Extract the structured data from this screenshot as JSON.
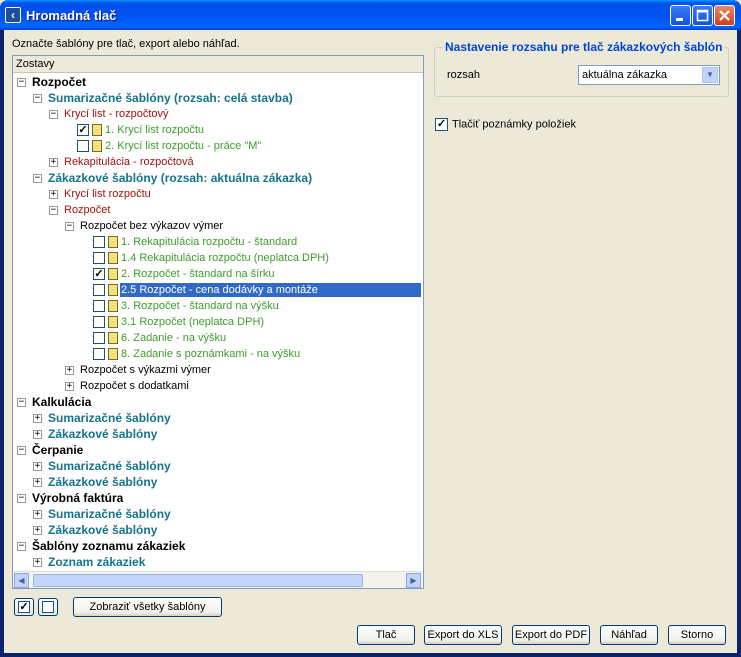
{
  "window": {
    "title": "Hromadná tlač"
  },
  "instruction": "Označte šablóny pre tlač, export alebo náhľad.",
  "tree": {
    "header": "Zostavy",
    "rows": [
      {
        "label": "Rozpočet",
        "style": "bold-top",
        "level": 0,
        "exp": "−"
      },
      {
        "label": "Sumarizačné šablóny (rozsah: celá stavba)",
        "style": "teal",
        "level": 1,
        "exp": "−"
      },
      {
        "label": "Krycí list - rozpočtový",
        "style": "red",
        "level": 2,
        "exp": "−"
      },
      {
        "label": "1. Krycí list rozpočtu",
        "style": "grn",
        "level": 3,
        "checked": true,
        "doc": true
      },
      {
        "label": "2. Krycí list rozpočtu - práce \"M\"",
        "style": "grn",
        "level": 3,
        "checked": false,
        "doc": true
      },
      {
        "label": "Rekapitulácia - rozpočtová",
        "style": "red",
        "level": 2,
        "exp": "+"
      },
      {
        "label": "Zákazkové šablóny (rozsah: aktuálna zákazka)",
        "style": "teal",
        "level": 1,
        "exp": "−"
      },
      {
        "label": "Krycí list rozpočtu",
        "style": "red",
        "level": 2,
        "exp": "+"
      },
      {
        "label": "Rozpočet",
        "style": "red",
        "level": 2,
        "exp": "−"
      },
      {
        "label": "Rozpočet bez výkazov výmer",
        "style": "blk",
        "level": 3,
        "exp": "−"
      },
      {
        "label": "1. Rekapitulácia rozpočtu - štandard",
        "style": "grn",
        "level": 4,
        "checked": false,
        "doc": true
      },
      {
        "label": "1.4 Rekapitulácia rozpočtu (neplatca DPH)",
        "style": "grn",
        "level": 4,
        "checked": false,
        "doc": true
      },
      {
        "label": "2. Rozpočet - štandard na šírku",
        "style": "grn",
        "level": 4,
        "checked": true,
        "doc": true
      },
      {
        "label": "2.5 Rozpočet - cena dodávky a montáže",
        "style": "grn",
        "level": 4,
        "checked": false,
        "doc": true,
        "selected": true
      },
      {
        "label": "3. Rozpočet - štandard na výšku",
        "style": "grn",
        "level": 4,
        "checked": false,
        "doc": true
      },
      {
        "label": "3.1 Rozpočet (neplatca DPH)",
        "style": "grn",
        "level": 4,
        "checked": false,
        "doc": true
      },
      {
        "label": "6. Zadanie - na výšku",
        "style": "grn",
        "level": 4,
        "checked": false,
        "doc": true
      },
      {
        "label": "8. Zadanie s poznámkami - na výšku",
        "style": "grn",
        "level": 4,
        "checked": false,
        "doc": true
      },
      {
        "label": "Rozpočet s výkazmi výmer",
        "style": "blk",
        "level": 3,
        "exp": "+"
      },
      {
        "label": "Rozpočet s dodatkami",
        "style": "blk",
        "level": 3,
        "exp": "+"
      },
      {
        "label": "Kalkulácia",
        "style": "bold-top",
        "level": 0,
        "exp": "−"
      },
      {
        "label": "Sumarizačné šablóny",
        "style": "teal",
        "level": 1,
        "exp": "+"
      },
      {
        "label": "Zákazkové šablóny",
        "style": "teal",
        "level": 1,
        "exp": "+"
      },
      {
        "label": "Čerpanie",
        "style": "bold-top",
        "level": 0,
        "exp": "−"
      },
      {
        "label": "Sumarizačné šablóny",
        "style": "teal",
        "level": 1,
        "exp": "+"
      },
      {
        "label": "Zákazkové šablóny",
        "style": "teal",
        "level": 1,
        "exp": "+"
      },
      {
        "label": "Výrobná faktúra",
        "style": "bold-top",
        "level": 0,
        "exp": "−"
      },
      {
        "label": "Sumarizačné šablóny",
        "style": "teal",
        "level": 1,
        "exp": "+"
      },
      {
        "label": "Zákazkové šablóny",
        "style": "teal",
        "level": 1,
        "exp": "+"
      },
      {
        "label": "Šablóny zoznamu zákaziek",
        "style": "bold-top",
        "level": 0,
        "exp": "−"
      },
      {
        "label": "Zoznam zákaziek",
        "style": "teal",
        "level": 1,
        "exp": "+"
      }
    ]
  },
  "range_settings": {
    "legend": "Nastavenie rozsahu pre tlač zákazkových šablón",
    "label": "rozsah",
    "selected": "aktuálna zákazka"
  },
  "print_notes": {
    "label": "Tlačiť poznámky položiek",
    "checked": true
  },
  "buttons": {
    "select_all_icon": "checkbox-checked-icon",
    "deselect_all_icon": "checkbox-empty-icon",
    "show_all": "Zobraziť všetky šablóny",
    "print": "Tlač",
    "export_xls": "Export do XLS",
    "export_pdf": "Export do PDF",
    "preview": "Náhľad",
    "cancel": "Storno"
  },
  "colors": {
    "title_bar": "#0053ee",
    "selection": "#316ac5",
    "legend": "#0046d5",
    "teal": "#14758a",
    "red": "#a01010",
    "green": "#3c9c2c"
  }
}
